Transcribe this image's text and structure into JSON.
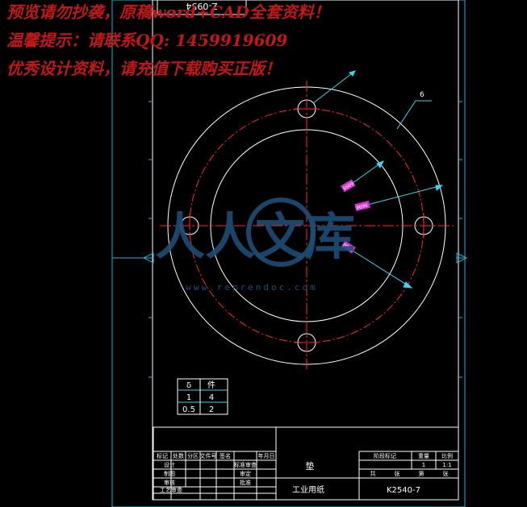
{
  "watermark": {
    "line1": "预览请勿抄袭，原稿word+CAD全套资料！",
    "line2": "温馨提示：请联系QQ: 1459919609",
    "line3": "优秀设计资料，请充值下载购买正版！"
  },
  "drawing_number_top": "Z-0954",
  "dimensions": {
    "thickness": "6",
    "overlay_1": "8000",
    "overlay_2": "0000",
    "overlay_3": "0000"
  },
  "part_table": {
    "header": [
      "δ",
      "件"
    ],
    "rows": [
      [
        "1",
        "4"
      ],
      [
        "0.5",
        "2"
      ]
    ]
  },
  "site_logo": {
    "text": "人人文库",
    "url": "www.renrendoc.com"
  },
  "title_block": {
    "part_name": "垫",
    "paper_label": "工业用纸",
    "drawing_code": "K2540-7",
    "revision_cols": [
      "标记",
      "处数",
      "分区",
      "文件号",
      "签名",
      "年月日"
    ],
    "sign_rows": [
      [
        "设计",
        "",
        "标准审查",
        ""
      ],
      [
        "制图",
        "",
        "审定",
        ""
      ],
      [
        "审核",
        "",
        "批准",
        ""
      ],
      [
        "工艺审查",
        "",
        "",
        ""
      ]
    ],
    "stage_header": [
      "阶段标记",
      "重量",
      "比例"
    ],
    "stage_values": [
      "",
      "1",
      "1:1"
    ],
    "sheet_row": [
      "共",
      "张",
      "第",
      "张"
    ]
  }
}
